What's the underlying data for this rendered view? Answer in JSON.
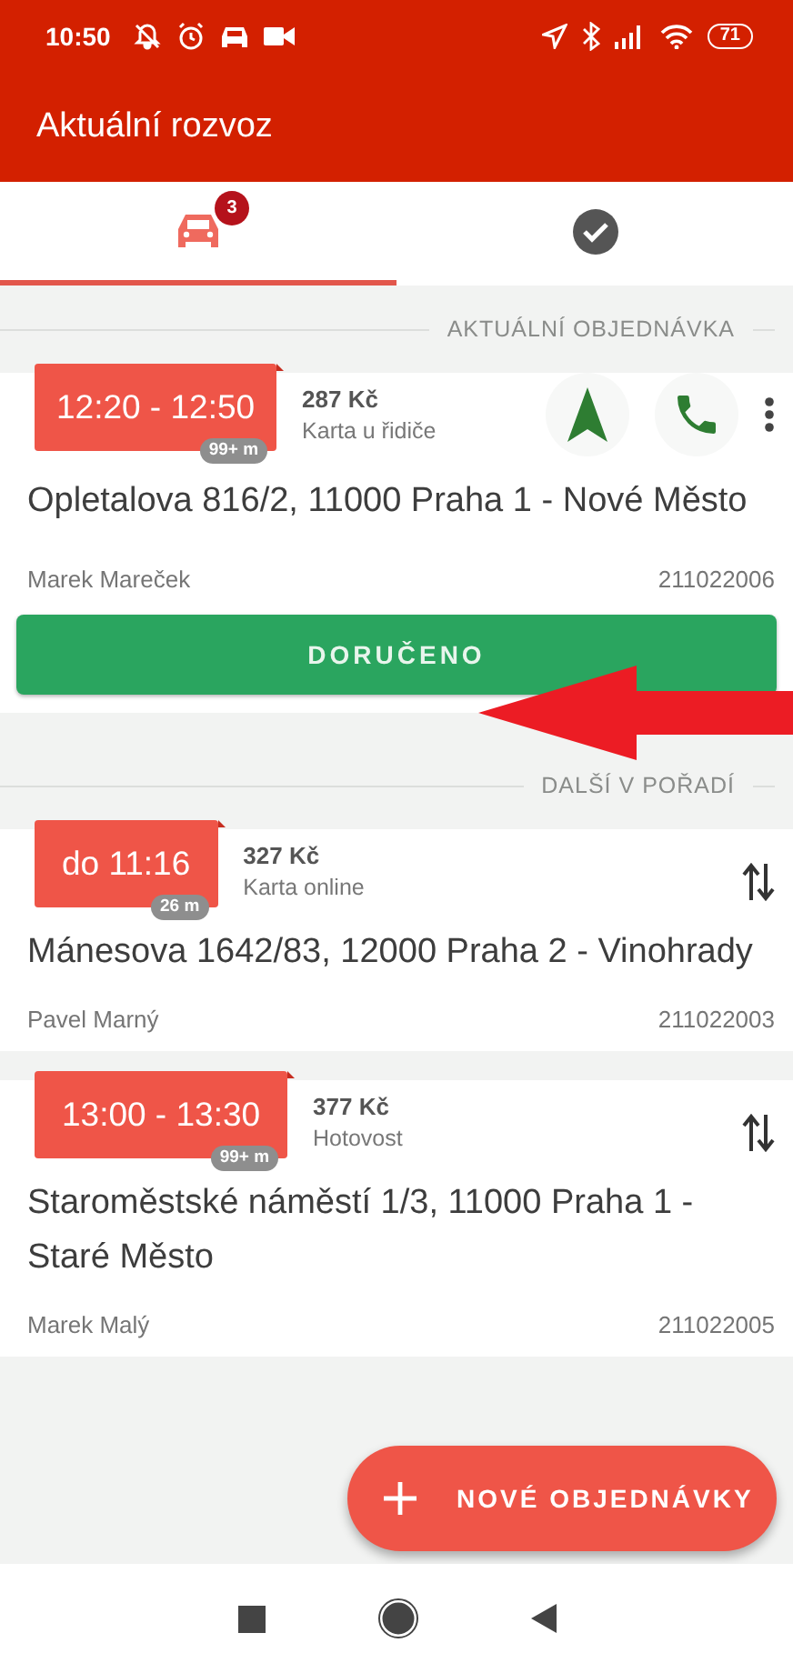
{
  "status_bar": {
    "time": "10:50",
    "battery": "71"
  },
  "app_bar": {
    "title": "Aktuální rozvoz"
  },
  "tabs": [
    {
      "kind": "car",
      "selected": true,
      "badge": "3"
    },
    {
      "kind": "check",
      "selected": false
    }
  ],
  "sections": [
    {
      "title": "AKTUÁLNÍ OBJEDNÁVKA",
      "orders": [
        {
          "kind": "current",
          "time": "12:20 - 12:50",
          "distance": "99+ m",
          "price": "287 Kč",
          "payment": "Karta u řidiče",
          "address": "Opletalova 816/2, 11000 Praha 1 - Nové Město",
          "customer": "Marek Mareček",
          "number": "211022006",
          "action": "DORUČENO"
        }
      ]
    },
    {
      "title": "DALŠÍ V POŘADÍ",
      "orders": [
        {
          "kind": "queued",
          "time": "do 11:16",
          "distance": "26 m",
          "price": "327 Kč",
          "payment": "Karta online",
          "address": "Mánesova 1642/83, 12000 Praha 2 - Vinohrady",
          "customer": "Pavel Marný",
          "number": "211022003"
        },
        {
          "kind": "queued",
          "time": "13:00 - 13:30",
          "distance": "99+ m",
          "price": "377 Kč",
          "payment": "Hotovost",
          "address": "Staroměstské náměstí 1/3, 11000 Praha 1 - Staré Město",
          "customer": "Marek Malý",
          "number": "211022005"
        }
      ]
    }
  ],
  "fab": {
    "label": "NOVÉ OBJEDNÁVKY"
  }
}
